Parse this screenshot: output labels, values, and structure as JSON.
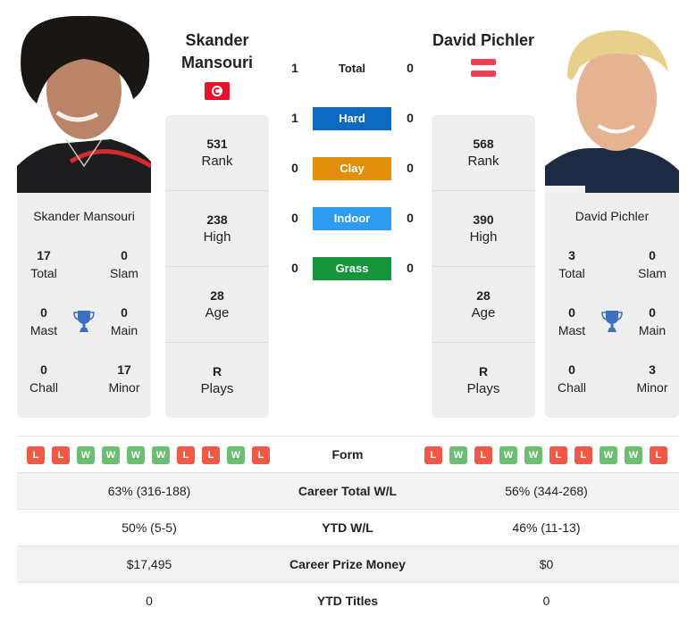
{
  "players": {
    "left": {
      "name_line1": "Skander",
      "name_line2": "Mansouri",
      "full_name": "Skander Mansouri",
      "flag": "tunisia-flag",
      "rank": "531",
      "rank_label": "Rank",
      "high": "238",
      "high_label": "High",
      "age": "28",
      "age_label": "Age",
      "plays": "R",
      "plays_label": "Plays",
      "titles": {
        "total": "17",
        "total_label": "Total",
        "slam": "0",
        "slam_label": "Slam",
        "mast": "0",
        "mast_label": "Mast",
        "main": "0",
        "main_label": "Main",
        "chall": "0",
        "chall_label": "Chall",
        "minor": "17",
        "minor_label": "Minor"
      }
    },
    "right": {
      "name": "David Pichler",
      "full_name": "David Pichler",
      "flag": "austria-flag",
      "rank": "568",
      "rank_label": "Rank",
      "high": "390",
      "high_label": "High",
      "age": "28",
      "age_label": "Age",
      "plays": "R",
      "plays_label": "Plays",
      "titles": {
        "total": "3",
        "total_label": "Total",
        "slam": "0",
        "slam_label": "Slam",
        "mast": "0",
        "mast_label": "Mast",
        "main": "0",
        "main_label": "Main",
        "chall": "0",
        "chall_label": "Chall",
        "minor": "3",
        "minor_label": "Minor"
      }
    }
  },
  "h2h": [
    {
      "label": "Total",
      "left": "1",
      "right": "0",
      "color": ""
    },
    {
      "label": "Hard",
      "left": "1",
      "right": "0",
      "color": "#0d6ac1"
    },
    {
      "label": "Clay",
      "left": "0",
      "right": "0",
      "color": "#e08e0b"
    },
    {
      "label": "Indoor",
      "left": "0",
      "right": "0",
      "color": "#2d9cf0"
    },
    {
      "label": "Grass",
      "left": "0",
      "right": "0",
      "color": "#16953c"
    }
  ],
  "table": {
    "form_label": "Form",
    "form_left": [
      "L",
      "L",
      "W",
      "W",
      "W",
      "W",
      "L",
      "L",
      "W",
      "L"
    ],
    "form_right": [
      "L",
      "W",
      "L",
      "W",
      "W",
      "L",
      "L",
      "W",
      "W",
      "L"
    ],
    "rows": [
      {
        "label": "Career Total W/L",
        "left": "63% (316-188)",
        "right": "56% (344-268)"
      },
      {
        "label": "YTD W/L",
        "left": "50% (5-5)",
        "right": "46% (11-13)"
      },
      {
        "label": "Career Prize Money",
        "left": "$17,495",
        "right": "$0"
      },
      {
        "label": "YTD Titles",
        "left": "0",
        "right": "0"
      }
    ]
  }
}
